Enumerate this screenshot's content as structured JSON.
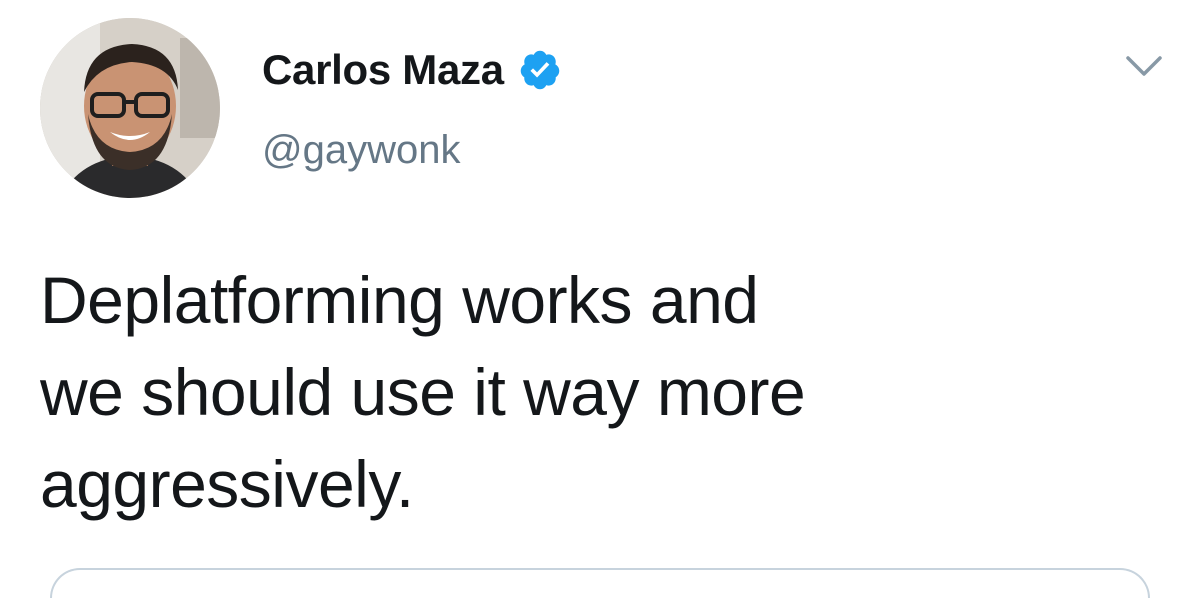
{
  "user": {
    "display_name": "Carlos Maza",
    "handle": "@gaywonk",
    "verified": true,
    "avatar_icon": "avatar-photo"
  },
  "tweet": {
    "lines": [
      "Deplatforming works and",
      "we should use it way more",
      "aggressively."
    ]
  },
  "icons": {
    "verified": "verified-badge-icon",
    "menu": "chevron-down-icon"
  },
  "colors": {
    "text": "#14171a",
    "secondary_text": "#657786",
    "verified_blue": "#1da1f2",
    "caret": "#8899a6",
    "divider": "#c7d3dd"
  }
}
